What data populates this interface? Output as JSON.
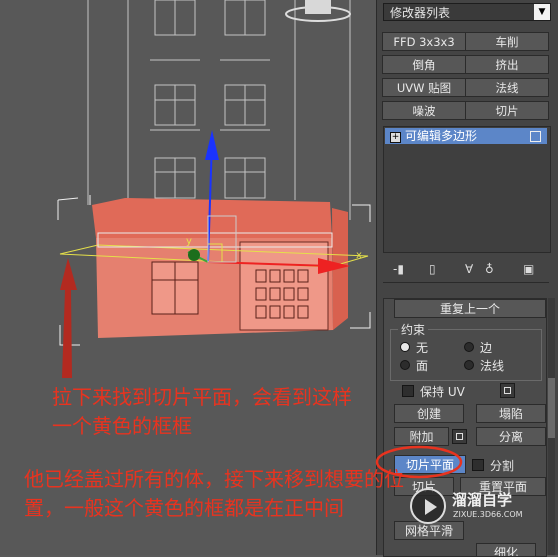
{
  "modifier_list": {
    "label": "修改器列表"
  },
  "modifier_buttons": [
    "FFD 3x3x3",
    "车削",
    "倒角",
    "挤出",
    "UVW 贴图",
    "法线",
    "噪波",
    "切片"
  ],
  "stack": {
    "item": "可编辑多边形"
  },
  "rollout": {
    "repeat_last": "重复上一个",
    "constraints_title": "约束",
    "radio_none": "无",
    "radio_edge": "边",
    "radio_face": "面",
    "radio_normal": "法线",
    "preserve_uv": "保持 UV",
    "create": "创建",
    "collapse": "塌陷",
    "attach": "附加",
    "detach": "分离",
    "slice_plane": "切片平面",
    "split": "分割",
    "reset_plane": "重置平面",
    "slice": "切片",
    "mesh_smooth": "网格平滑",
    "tessellate": "细化"
  },
  "viewport": {
    "axis_y": "y",
    "axis_x": "x"
  },
  "annotation": {
    "line1": "拉下来找到切片平面，会看到这样",
    "line2": "一个黄色的框框",
    "line3": "他已经盖过所有的体，接下来移到想要的位",
    "line4": "置，一般这个黄色的框都是在正中间"
  },
  "watermark": {
    "title": "溜溜自学",
    "url": "ZIXUE.3D66.COM"
  },
  "colors": {
    "annotation": "#e8331f",
    "building": "#e4705f",
    "slice_plane": "#e5e04a",
    "gizmo_blue": "#1a33ff",
    "gizmo_red": "#ee2222",
    "highlight": "#5c86c8"
  }
}
